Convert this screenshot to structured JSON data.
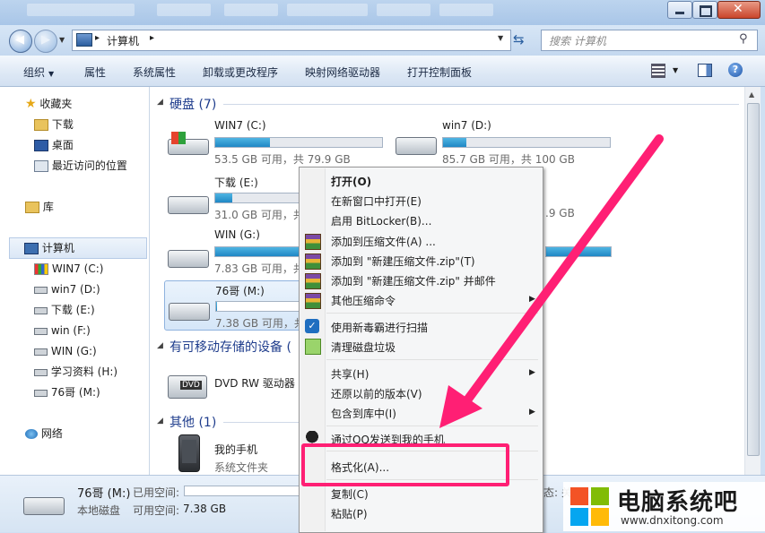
{
  "address": {
    "path_label": "计算机",
    "search_placeholder": "搜索 计算机"
  },
  "toolbar": {
    "items": [
      "组织",
      "属性",
      "系统属性",
      "卸载或更改程序",
      "映射网络驱动器",
      "打开控制面板"
    ]
  },
  "nav": {
    "favorites": "收藏夹",
    "fav_items": [
      "下载",
      "桌面",
      "最近访问的位置"
    ],
    "libraries": "库",
    "computer": "计算机",
    "drives": [
      "WIN7 (C:)",
      "win7 (D:)",
      "下载 (E:)",
      "win (F:)",
      "WIN (G:)",
      "学习资料 (H:)",
      "76哥 (M:)"
    ],
    "network": "网络"
  },
  "groups": {
    "hdd": "硬盘 (7)",
    "removable": "有可移动存储的设备 (",
    "other": "其他 (1)"
  },
  "drives": [
    {
      "name": "WIN7 (C:)",
      "free": "53.5 GB 可用，共 79.9 GB",
      "used_pct": 33
    },
    {
      "name": "win7 (D:)",
      "free": "85.7 GB 可用，共 100 GB",
      "used_pct": 14
    },
    {
      "name": "下载 (E:)",
      "free": "31.0 GB 可用，共",
      "used_pct": 20
    },
    {
      "name": "",
      "free": ".9 GB",
      "used_pct": 0
    },
    {
      "name": "WIN (G:)",
      "free": "7.83 GB 可用，共",
      "used_pct": 93
    },
    {
      "name": "",
      "free": "",
      "used_pct": 0
    },
    {
      "name": "76哥 (M:)",
      "free": "7.38 GB 可用，共",
      "used_pct": 1
    }
  ],
  "dvd": {
    "name": "DVD RW 驱动器",
    "badge": "DVD"
  },
  "phone": {
    "name": "我的手机",
    "sub": "系统文件夹"
  },
  "details": {
    "name": "76哥 (M:)",
    "used_label": "已用空间:",
    "free_label": "可用空间:",
    "free_value": "7.38 GB",
    "type": "本地磁盘",
    "right_text": "态: 关"
  },
  "context_menu": {
    "items": [
      "打开(O)",
      "在新窗口中打开(E)",
      "启用 BitLocker(B)...",
      "添加到压缩文件(A) ...",
      "添加到 \"新建压缩文件.zip\"(T)",
      "添加到 \"新建压缩文件.zip\" 并邮件",
      "其他压缩命令",
      "使用新毒霸进行扫描",
      "清理磁盘垃圾",
      "共享(H)",
      "还原以前的版本(V)",
      "包含到库中(I)",
      "通过QQ发送到我的手机",
      "格式化(A)...",
      "复制(C)",
      "粘贴(P)"
    ]
  },
  "watermark": {
    "title": "电脑系统吧",
    "url": "www.dnxitong.com"
  },
  "colors": {
    "accent": "#ff1f74",
    "bar_fill": "#1f87c4",
    "bar_full": "#1f87c4"
  }
}
